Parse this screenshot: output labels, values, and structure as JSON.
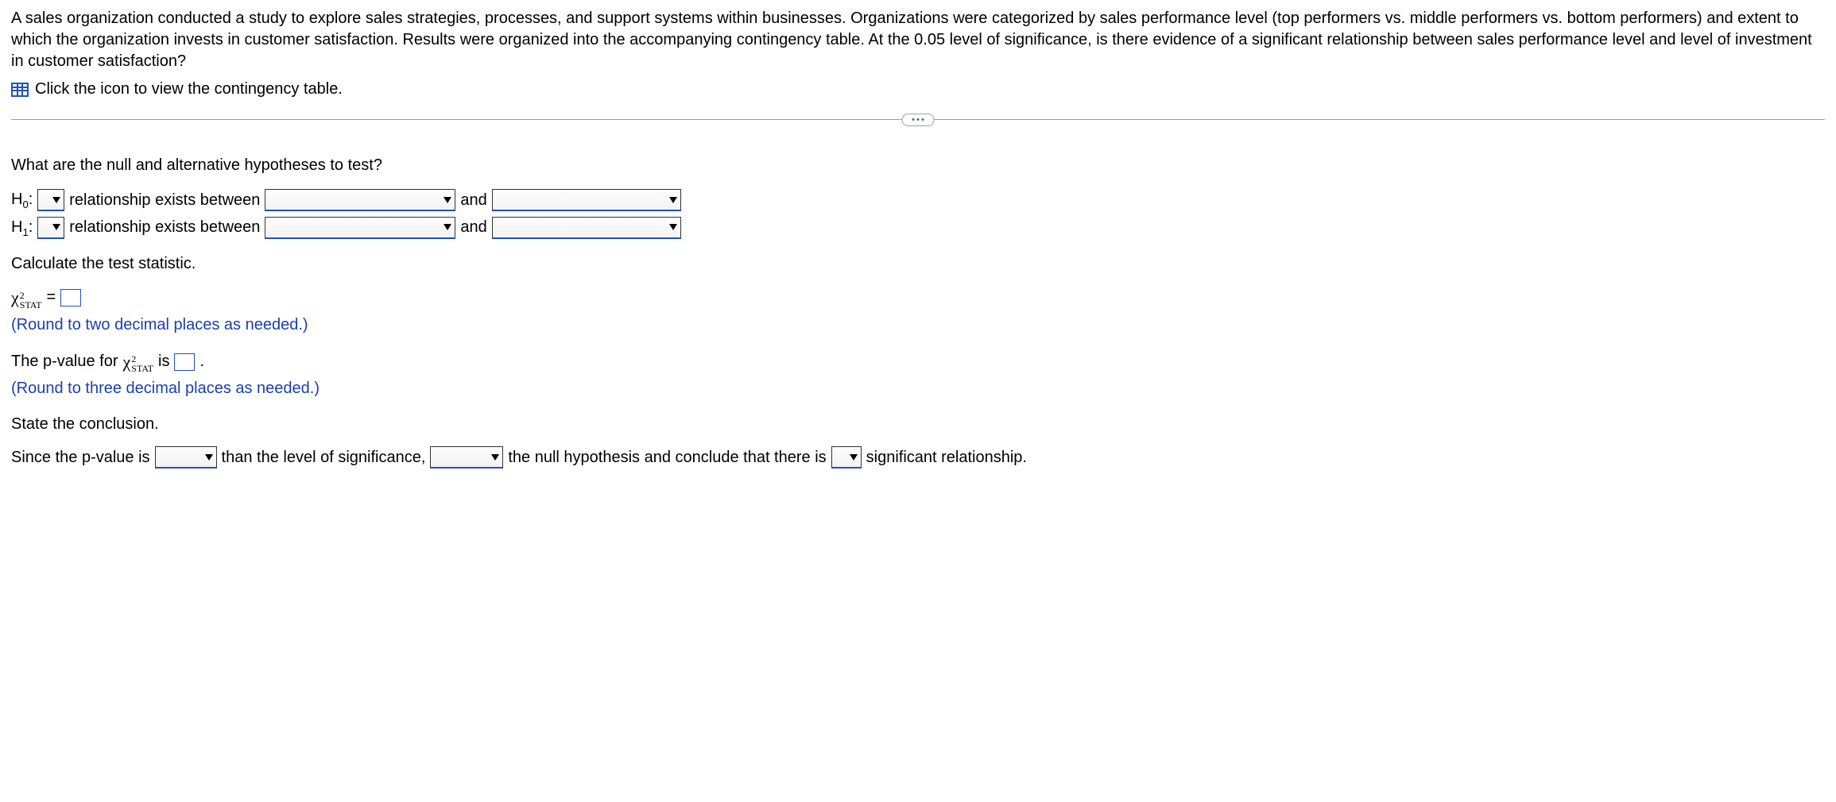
{
  "problem": {
    "text": "A sales organization conducted a study to explore sales strategies, processes, and support systems within businesses. Organizations were categorized by sales performance level (top performers vs. middle performers vs. bottom performers) and extent to which the organization invests in customer satisfaction. Results were organized into the accompanying contingency table. At the 0.05 level of significance, is there evidence of a significant relationship between sales performance level and level of investment in customer satisfaction?",
    "link_text": "Click the icon to view the contingency table."
  },
  "q1": {
    "prompt": "What are the null and alternative hypotheses to test?",
    "h0_label": "H",
    "h0_sub": "0",
    "h1_label": "H",
    "h1_sub": "1",
    "colon": ":",
    "rel_text": "relationship exists between",
    "and_text": "and"
  },
  "q2": {
    "prompt": "Calculate the test statistic.",
    "chi": "χ",
    "stat_sub": "STAT",
    "two": "2",
    "equals": "=",
    "hint": "(Round to two decimal places as needed.)"
  },
  "q3": {
    "pre": "The p-value for",
    "is": "is",
    "period": ".",
    "hint": "(Round to three decimal places as needed.)"
  },
  "q4": {
    "prompt": "State the conclusion.",
    "t1": "Since the p-value is",
    "t2": "than the level of significance,",
    "t3": "the null hypothesis and conclude that there is",
    "t4": "significant relationship."
  }
}
